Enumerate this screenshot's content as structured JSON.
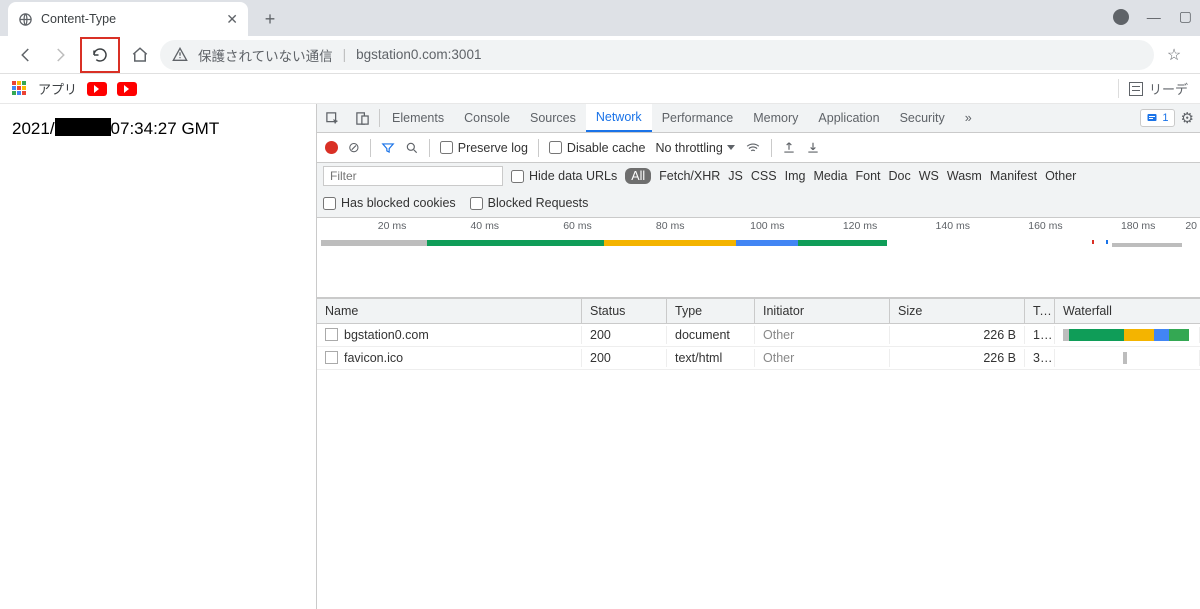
{
  "window": {
    "minimize": "—",
    "close": "✕"
  },
  "tab": {
    "title": "Content-Type"
  },
  "addressbar": {
    "security_label": "保護されていない通信",
    "url": "bgstation0.com:3001"
  },
  "bookmarks": {
    "apps": "アプリ",
    "reading_list": "リーデ"
  },
  "page_body": {
    "prefix": "2021/",
    "suffix": "07:34:27 GMT"
  },
  "devtools": {
    "tabs": {
      "elements": "Elements",
      "console": "Console",
      "sources": "Sources",
      "network": "Network",
      "performance": "Performance",
      "memory": "Memory",
      "application": "Application",
      "security": "Security",
      "more": "»"
    },
    "issue_count": "1",
    "toolbar": {
      "preserve_log": "Preserve log",
      "disable_cache": "Disable cache",
      "throttling": "No throttling"
    },
    "filter": {
      "placeholder": "Filter",
      "hide_urls": "Hide data URLs",
      "types": {
        "all": "All",
        "fetch": "Fetch/XHR",
        "js": "JS",
        "css": "CSS",
        "img": "Img",
        "media": "Media",
        "font": "Font",
        "doc": "Doc",
        "ws": "WS",
        "wasm": "Wasm",
        "manifest": "Manifest",
        "other": "Other"
      },
      "blocked_cookies": "Has blocked cookies",
      "blocked_requests": "Blocked Requests"
    },
    "timeline": {
      "ticks": [
        "20 ms",
        "40 ms",
        "60 ms",
        "80 ms",
        "100 ms",
        "120 ms",
        "140 ms",
        "160 ms",
        "180 ms",
        "20"
      ]
    },
    "table": {
      "columns": {
        "name": "Name",
        "status": "Status",
        "type": "Type",
        "initiator": "Initiator",
        "size": "Size",
        "time": "T...",
        "waterfall": "Waterfall"
      },
      "rows": [
        {
          "name": "bgstation0.com",
          "status": "200",
          "type": "document",
          "initiator": "Other",
          "size": "226 B",
          "time": "1..."
        },
        {
          "name": "favicon.ico",
          "status": "200",
          "type": "text/html",
          "initiator": "Other",
          "size": "226 B",
          "time": "3..."
        }
      ]
    }
  }
}
